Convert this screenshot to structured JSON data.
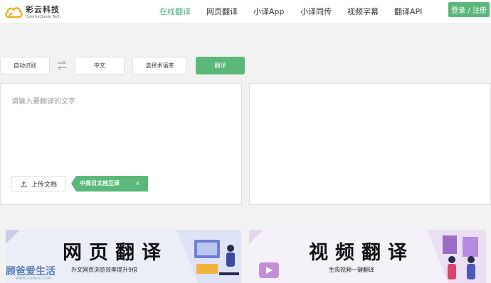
{
  "header": {
    "logo_cn": "彩云科技",
    "logo_en": "ColorfulClouds Tech.",
    "nav": [
      {
        "label": "在线翻译",
        "active": true
      },
      {
        "label": "网页翻译",
        "active": false
      },
      {
        "label": "小译App",
        "active": false
      },
      {
        "label": "小译同传",
        "active": false
      },
      {
        "label": "视频字幕",
        "active": false
      },
      {
        "label": "翻译API",
        "active": false
      }
    ],
    "login_label": "登录 / 注册"
  },
  "toolbar": {
    "source_lang": "自动识别",
    "target_lang": "中文",
    "glossary_label": "选择术语库",
    "translate_label": "翻译"
  },
  "input": {
    "placeholder": "请输入要翻译的文字",
    "upload_label": "上传文档",
    "doc_tag_label": "中英日文档互译",
    "doc_tag_close": "×"
  },
  "banners": {
    "web": {
      "title": "网页翻译",
      "subtitle": "外文网页浏览效率提升9倍"
    },
    "video": {
      "title": "视频翻译",
      "subtitle": "生肉视频一键翻译"
    }
  },
  "watermark": {
    "text": "顾爸爱生活",
    "sub": "WWW.GUBAIXI.COM"
  },
  "colors": {
    "accent": "#5cb87a",
    "nav_active": "#4caf7a",
    "panel_border": "#dedede",
    "background": "#f2f2f2"
  },
  "icons": [
    "cloud-logo-icon",
    "swap-arrows-icon",
    "upload-icon",
    "close-icon"
  ]
}
